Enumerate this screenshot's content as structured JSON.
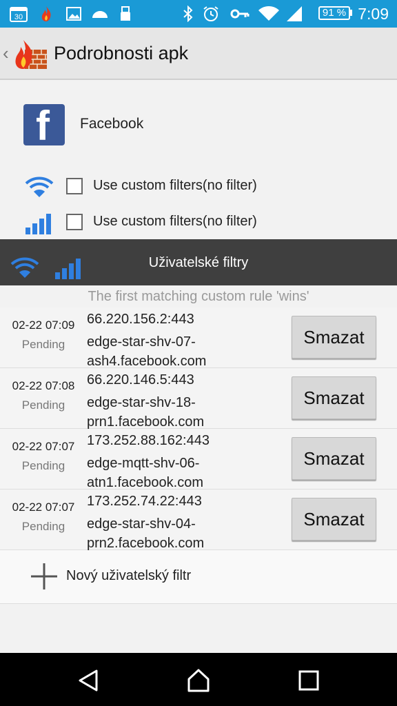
{
  "status_bar": {
    "notification_icons": [
      "calendar-icon",
      "firewall-flame-icon",
      "image-icon",
      "cloud-icon",
      "usb-icon"
    ],
    "calendar_day": "30",
    "system_icons": [
      "bluetooth-icon",
      "alarm-icon",
      "vpn-key-icon",
      "wifi-icon",
      "cell-signal-icon"
    ],
    "battery": "91 %",
    "time": "7:09"
  },
  "app_bar": {
    "back_glyph": "‹",
    "title": "Podrobnosti apk"
  },
  "app": {
    "icon_letter": "f",
    "name": "Facebook",
    "brand_color": "#3b5998"
  },
  "custom_filters": {
    "wifi_label": "Use custom filters(no filter)",
    "mobile_label": "Use custom filters(no filter)"
  },
  "filters_header": {
    "title": "Uživatelské filtry"
  },
  "hint": "The first matching custom rule 'wins'",
  "rules": [
    {
      "time": "02-22 07:09",
      "status": "Pending",
      "address": "66.220.156.2:443",
      "host": "edge-star-shv-07-ash4.facebook.com",
      "button": "Smazat"
    },
    {
      "time": "02-22 07:08",
      "status": "Pending",
      "address": "66.220.146.5:443",
      "host": "edge-star-shv-18-prn1.facebook.com",
      "button": "Smazat"
    },
    {
      "time": "02-22 07:07",
      "status": "Pending",
      "address": "173.252.88.162:443",
      "host": "edge-mqtt-shv-06-atn1.facebook.com",
      "button": "Smazat"
    },
    {
      "time": "02-22 07:07",
      "status": "Pending",
      "address": "173.252.74.22:443",
      "host": "edge-star-shv-04-prn2.facebook.com",
      "button": "Smazat"
    }
  ],
  "add_filter": {
    "label": "Nový uživatelský filtr"
  },
  "nav_bar": {
    "buttons": [
      "back-icon",
      "home-icon",
      "recents-icon"
    ]
  },
  "colors": {
    "status_bar": "#1a9ad6",
    "accent_blue": "#2f7fe0",
    "header_bar": "#3f3f3f"
  }
}
